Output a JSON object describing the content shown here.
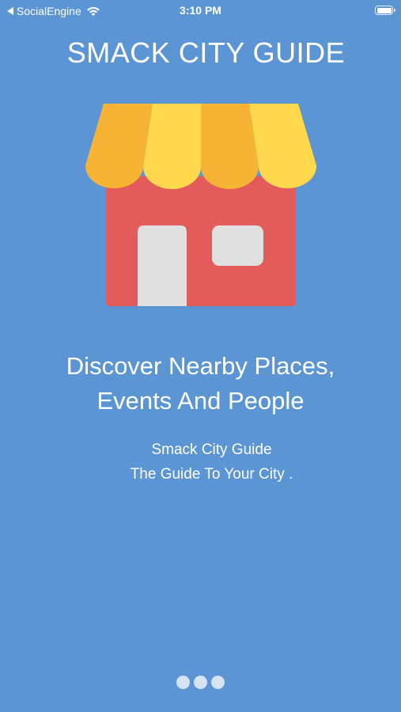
{
  "status_bar": {
    "back_app": "SocialEngine",
    "time": "3:10 PM",
    "icons": [
      "back-arrow-icon",
      "wifi-icon",
      "battery-icon"
    ]
  },
  "app_title": "SMACK CITY GUIDE",
  "illustration": {
    "icon": "storefront-icon",
    "colors": {
      "awning_dark": "#F7B334",
      "awning_light": "#FFD84D",
      "wall": "#E35B5B",
      "door_window": "#E0E0E0"
    }
  },
  "headline": {
    "line1": "Discover Nearby Places,",
    "line2": "Events And People"
  },
  "subtitle": {
    "line1": "Smack City Guide",
    "line2": "The Guide To Your City ."
  },
  "pager": {
    "page_count": 3
  },
  "colors": {
    "background": "#5B95D3",
    "text": "#FFFFFF",
    "dot": "#D7E2F2"
  }
}
